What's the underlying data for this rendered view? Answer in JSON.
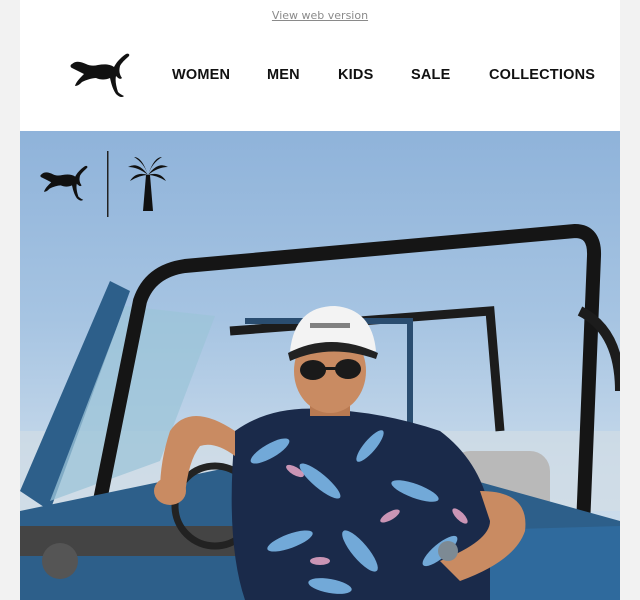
{
  "preheader": {
    "web_version_label": "View web version"
  },
  "brand": {
    "logo_icon": "puma-cat-logo-icon",
    "color": "#111111"
  },
  "nav": {
    "items": [
      {
        "label": "WOMEN"
      },
      {
        "label": "MEN"
      },
      {
        "label": "KIDS"
      },
      {
        "label": "SALE"
      },
      {
        "label": "COLLECTIONS"
      }
    ]
  },
  "hero": {
    "cobrand_icons": [
      "puma-cat-logo-icon",
      "palm-tree-icon"
    ],
    "colors": {
      "sky": "#a6c4e2",
      "vehicle_blue": "#2d5f8a",
      "shirt_navy": "#1a2a4a"
    }
  }
}
